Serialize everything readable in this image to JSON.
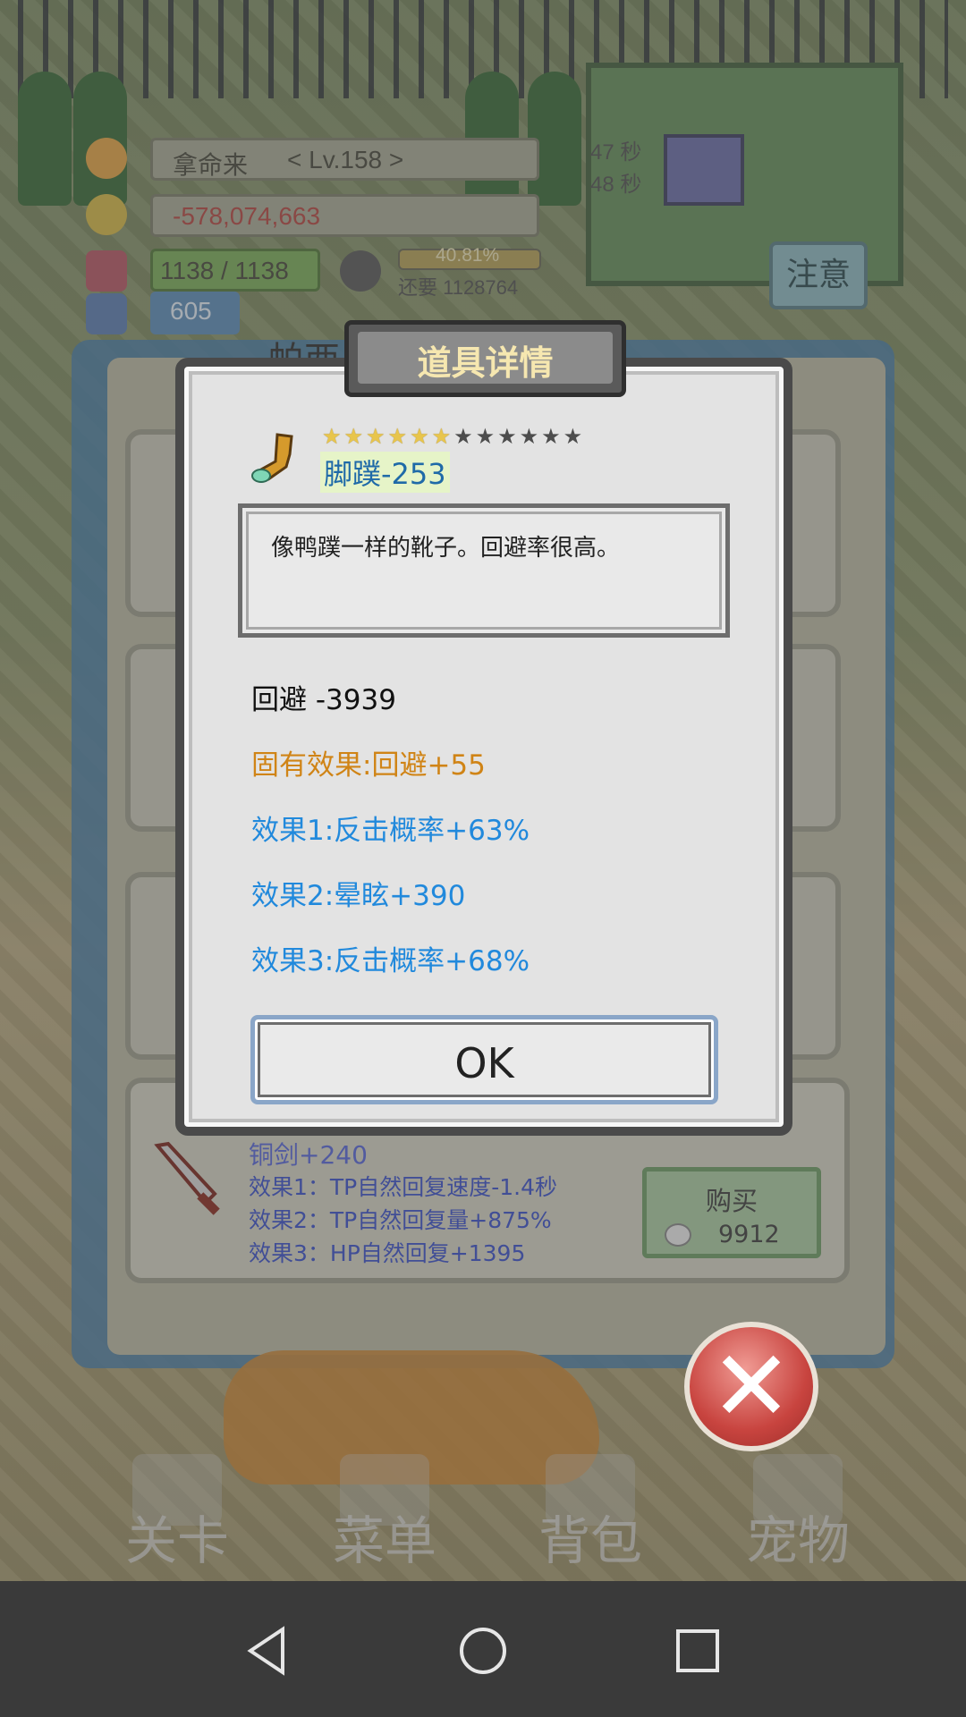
{
  "hud": {
    "player_name": "拿命来",
    "level": "< Lv.158 >",
    "gold": "-578,074,663",
    "hp": "1138 / 1138",
    "tp": "605",
    "exp_percent": "40.81%",
    "exp_remaining": "还要 1128764",
    "timer_1": "47 秒",
    "timer_2": "48 秒",
    "notice_label": "注意"
  },
  "dialog": {
    "title": "道具详情",
    "stars_filled": 6,
    "stars_total": 12,
    "item_name": "脚蹼-253",
    "description": "像鸭蹼一样的靴子。回避率很高。",
    "base_stat": "回避  -3939",
    "fixed_effect": "固有效果:回避+55",
    "effects": [
      "效果1:反击概率+63%",
      "效果2:晕眩+390",
      "效果3:反击概率+68%"
    ],
    "ok_label": "OK"
  },
  "shop": {
    "partial_title": "帕西",
    "bottom_item": {
      "name_partial": "铜剑+240",
      "effects": [
        "效果1：TP自然回复速度-1.4秒",
        "效果2：TP自然回复量+875%",
        "效果3：HP自然回复+1395"
      ],
      "buy_label": "购买",
      "price": "9912"
    }
  },
  "bottom_menu": [
    "关卡",
    "菜单",
    "背包",
    "宠物"
  ],
  "colors": {
    "fixed_effect": "#d08416",
    "effect": "#2189dc",
    "item_name": "#1f6aa8",
    "close_button": "#c8443f"
  }
}
